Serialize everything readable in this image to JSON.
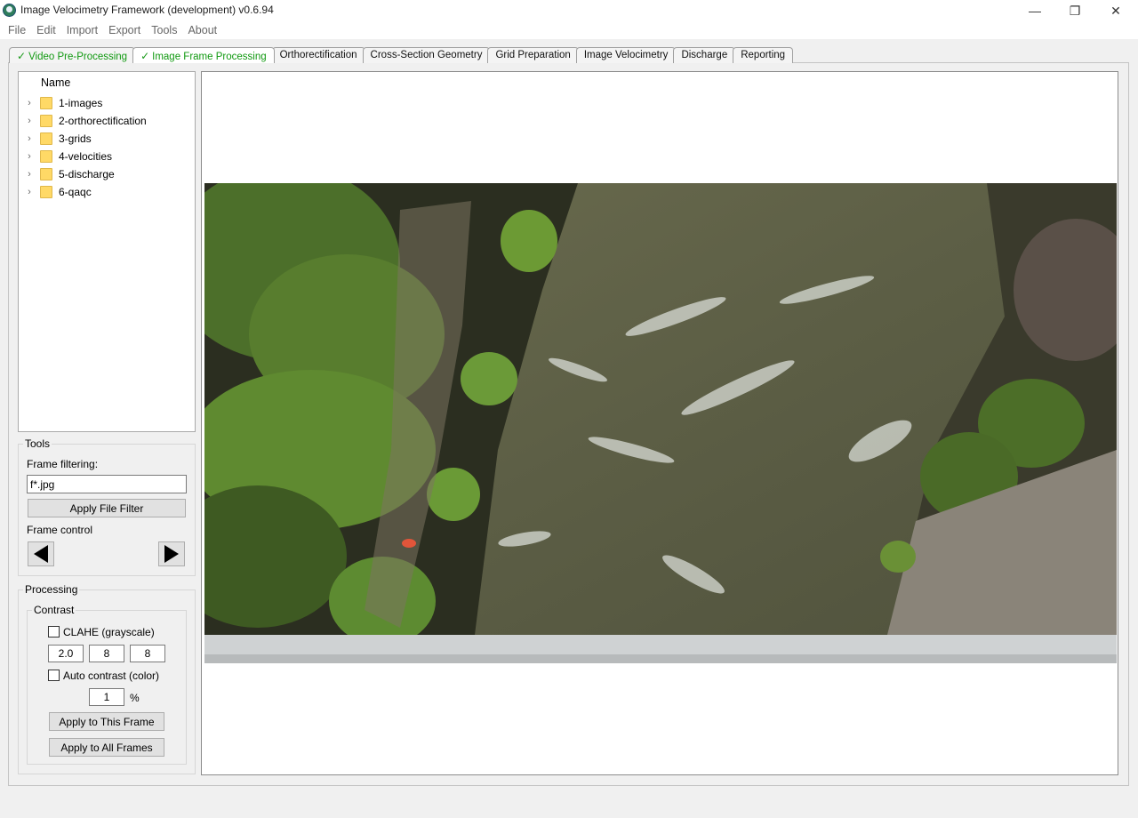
{
  "window": {
    "title": "Image Velocimetry Framework (development) v0.6.94",
    "controls": [
      "—",
      "❐",
      "✕"
    ]
  },
  "menu": [
    "File",
    "Edit",
    "Import",
    "Export",
    "Tools",
    "About"
  ],
  "tabs": [
    {
      "label": "Video Pre-Processing",
      "done": true
    },
    {
      "label": "Image Frame Processing",
      "done": true
    },
    {
      "label": "Orthorectification",
      "done": false
    },
    {
      "label": "Cross-Section Geometry",
      "done": false
    },
    {
      "label": "Grid Preparation",
      "done": false
    },
    {
      "label": "Image Velocimetry",
      "done": false
    },
    {
      "label": "Discharge",
      "done": false
    },
    {
      "label": "Reporting",
      "done": false
    }
  ],
  "tree": {
    "header": "Name",
    "items": [
      "1-images",
      "2-orthorectification",
      "3-grids",
      "4-velocities",
      "5-discharge",
      "6-qaqc"
    ]
  },
  "tools": {
    "title": "Tools",
    "filter_label": "Frame filtering:",
    "filter_value": "f*.jpg",
    "apply_filter": "Apply File Filter",
    "frame_control": "Frame control"
  },
  "processing": {
    "title": "Processing",
    "contrast_title": "Contrast",
    "clahe_label": "CLAHE (grayscale)",
    "clahe_values": [
      "2.0",
      "8",
      "8"
    ],
    "auto_contrast_label": "Auto contrast (color)",
    "auto_value": "1",
    "auto_unit": "%",
    "apply_this": "Apply to This Frame",
    "apply_all": "Apply to All Frames"
  },
  "colors": {
    "done_tab": "#119911",
    "folder": "#ffd966",
    "water": "#5e6147",
    "vegetation": "#4f7a2a"
  }
}
